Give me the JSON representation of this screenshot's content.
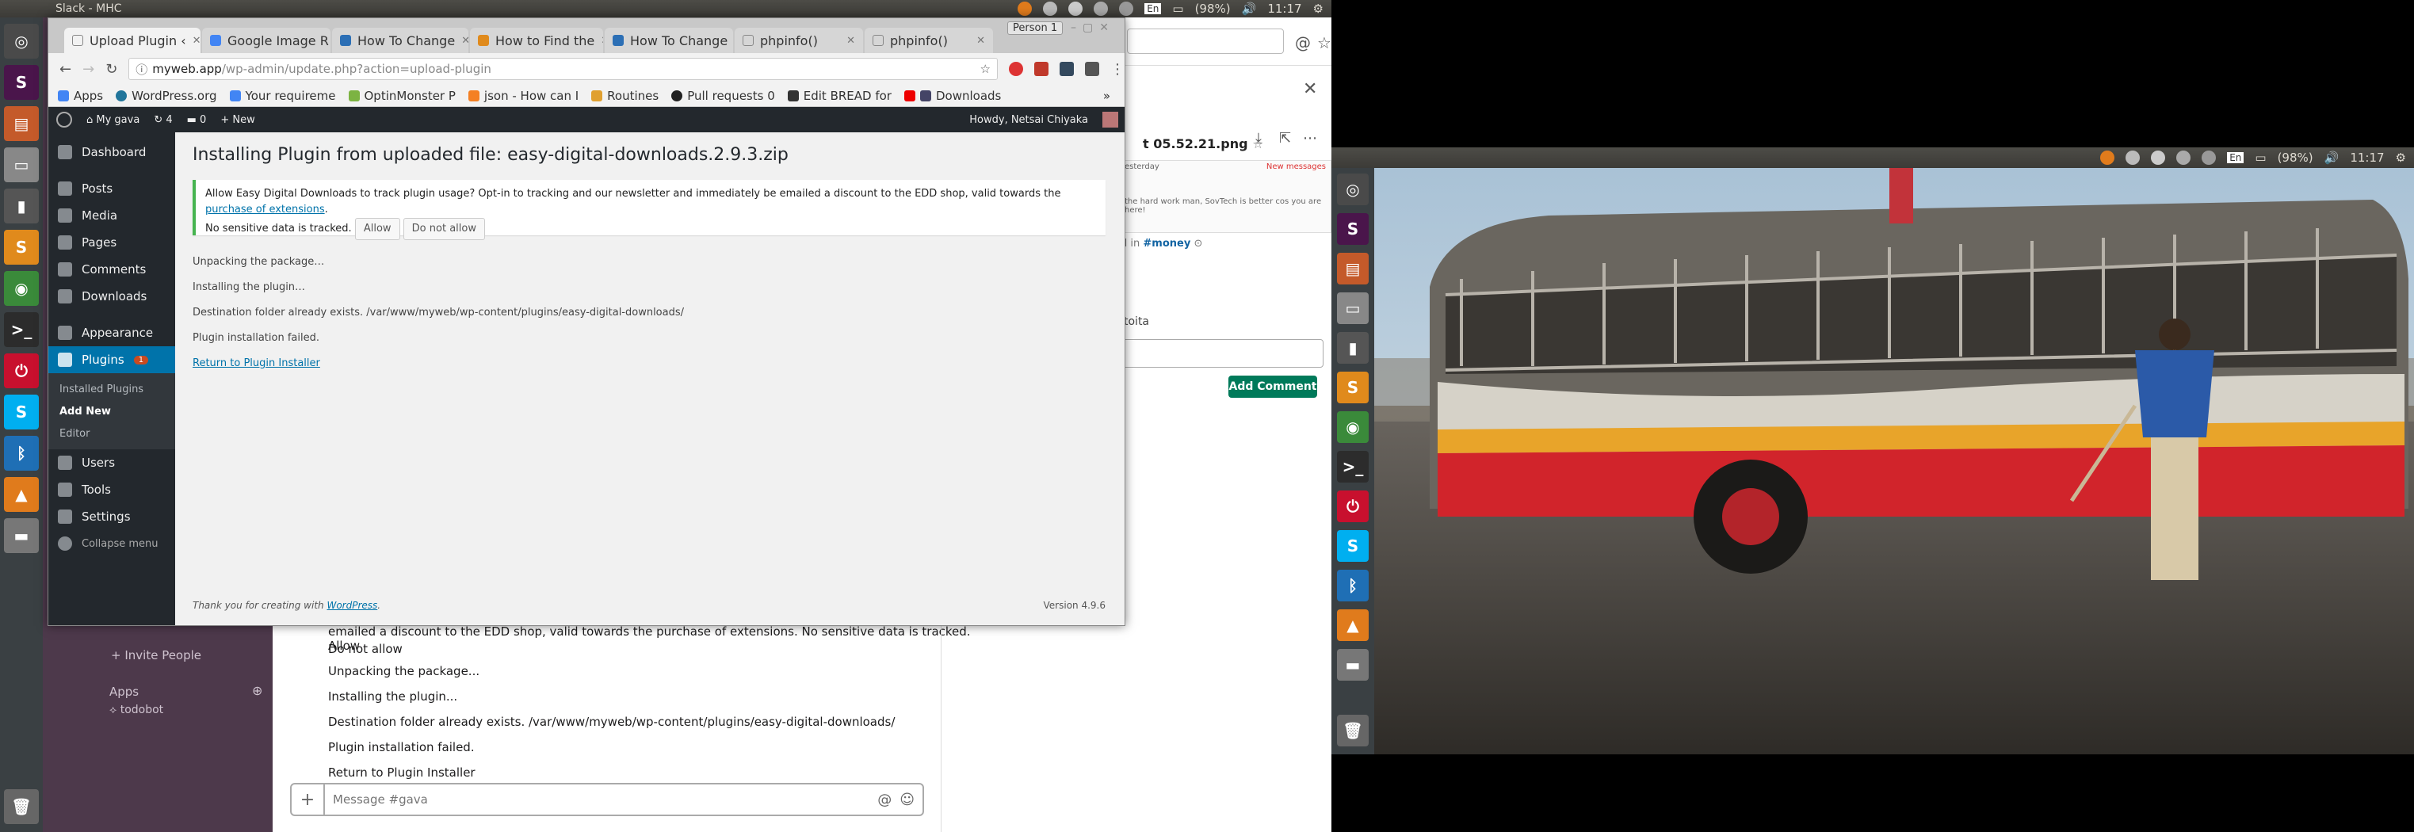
{
  "desktop_left": {
    "title": "Slack - MHC",
    "tray": {
      "battery": "(98%)",
      "time": "11:17",
      "kbd": "En"
    }
  },
  "desktop_right": {
    "tray": {
      "battery": "(98%)",
      "time": "11:17",
      "kbd": "En"
    }
  },
  "launcher_icons": [
    "ubuntu-icon",
    "slack-icon",
    "files-icon",
    "drive-icon",
    "terminal-icon",
    "sublime-icon",
    "chrome-icon",
    "terminal2-icon",
    "power-icon",
    "skype-icon",
    "bluetooth-icon",
    "vlc-icon",
    "removable-icon",
    "trash-icon"
  ],
  "browser": {
    "profile": "Person 1",
    "tabs": [
      {
        "label": "Upload Plugin ‹",
        "active": true
      },
      {
        "label": "Google Image R"
      },
      {
        "label": "How To Change"
      },
      {
        "label": "How to Find the"
      },
      {
        "label": "How To Change"
      },
      {
        "label": "phpinfo()"
      },
      {
        "label": "phpinfo()"
      }
    ],
    "url_host": "myweb.app",
    "url_path": "/wp-admin/update.php?action=upload-plugin",
    "bookmarks": [
      "Apps",
      "WordPress.org",
      "Your requireme",
      "OptinMonster P",
      "json - How can I",
      "Routines",
      "Pull requests 0",
      "Edit BREAD for",
      "Downloads"
    ],
    "more": "»"
  },
  "wp": {
    "adminbar": {
      "site": "My gava",
      "updates": "4",
      "comments": "0",
      "new": "New",
      "howdy": "Howdy, Netsai Chiyaka"
    },
    "menu": [
      {
        "label": "Dashboard"
      },
      {
        "label": "Posts"
      },
      {
        "label": "Media"
      },
      {
        "label": "Pages"
      },
      {
        "label": "Comments"
      },
      {
        "label": "Downloads"
      },
      {
        "label": "Appearance"
      },
      {
        "label": "Plugins",
        "badge": "1"
      },
      {
        "label": "Users"
      },
      {
        "label": "Tools"
      },
      {
        "label": "Settings"
      },
      {
        "label": "Collapse menu"
      }
    ],
    "submenu": [
      "Installed Plugins",
      "Add New",
      "Editor"
    ],
    "heading": "Installing Plugin from uploaded file: easy-digital-downloads.2.9.3.zip",
    "notice_text": "Allow Easy Digital Downloads to track plugin usage? Opt-in to tracking and our newsletter and immediately be emailed a discount to the EDD shop, valid towards the",
    "notice_link": "purchase of extensions",
    "notice_end": ".",
    "notice_text2": "No sensitive data is tracked.",
    "allow": "Allow",
    "dont_allow": "Do not allow",
    "log": [
      "Unpacking the package…",
      "Installing the plugin…",
      "Destination folder already exists. /var/www/myweb/wp-content/plugins/easy-digital-downloads/",
      "Plugin installation failed."
    ],
    "return_link": "Return to Plugin Installer",
    "footer_thanks": "Thank you for creating with",
    "footer_link": "WordPress",
    "footer_dot": ".",
    "version": "Version 4.9.6"
  },
  "slack": {
    "invite": "Invite People",
    "apps": "Apps",
    "todobot": "todobot",
    "messages": [
      "emailed a discount to the EDD shop, valid towards the purchase of extensions. No sensitive data is tracked. Allow",
      "Do not allow",
      "Unpacking the package...",
      "Installing the plugin...",
      "Destination folder already exists. /var/www/myweb/wp-content/plugins/easy-digital-downloads/",
      "Plugin installation failed.",
      "Return to Plugin Installer"
    ],
    "placeholder": "Message #gava",
    "file_title": "t 05.52.21.png",
    "shared_in": "d in",
    "channel": "#money",
    "comment_label": "toita",
    "add_comment": "Add Comment",
    "preview_text": "the hard work man, SovTech is better cos you are here!",
    "preview_date": "esterday",
    "preview_new": "New messages"
  }
}
